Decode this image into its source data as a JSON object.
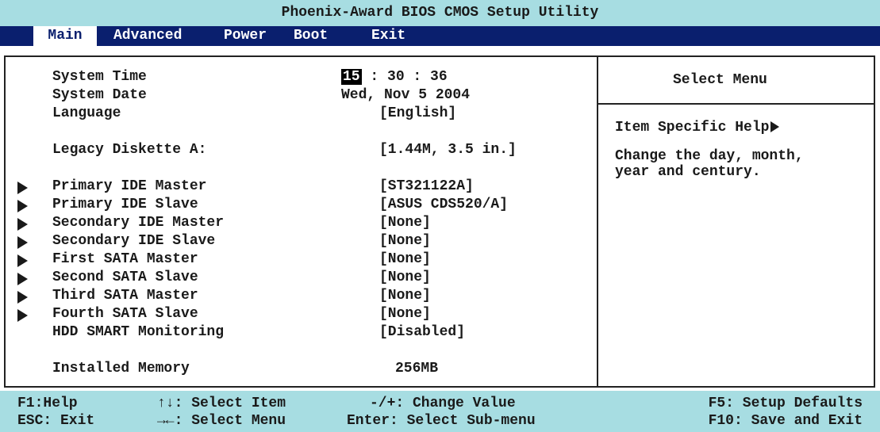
{
  "title": "Phoenix-Award BIOS CMOS Setup Utility",
  "menu": [
    {
      "label": "Main",
      "active": true
    },
    {
      "label": "Advanced",
      "active": false
    },
    {
      "label": "Power",
      "active": false
    },
    {
      "label": "Boot",
      "active": false
    },
    {
      "label": "Exit",
      "active": false
    }
  ],
  "time": {
    "hour": "15",
    "rest": ": 30 : 36"
  },
  "settings": [
    {
      "label": "System Time",
      "value": "",
      "submenu": false
    },
    {
      "label": "System Date",
      "value": "Wed, Nov 5 2004",
      "submenu": false
    },
    {
      "label": "Language",
      "value": "[English]",
      "submenu": false
    },
    {
      "label": "Legacy Diskette A:",
      "value": "[1.44M, 3.5 in.]",
      "submenu": false
    },
    {
      "label": "Primary IDE Master",
      "value": "[ST321122A]",
      "submenu": true
    },
    {
      "label": "Primary IDE Slave",
      "value": "[ASUS CDS520/A]",
      "submenu": true
    },
    {
      "label": "Secondary IDE Master",
      "value": "[None]",
      "submenu": true
    },
    {
      "label": "Secondary IDE Slave",
      "value": "[None]",
      "submenu": true
    },
    {
      "label": "First SATA Master",
      "value": "[None]",
      "submenu": true
    },
    {
      "label": "Second SATA Slave",
      "value": "[None]",
      "submenu": true
    },
    {
      "label": "Third SATA Master",
      "value": "[None]",
      "submenu": true
    },
    {
      "label": "Fourth SATA Slave",
      "value": "[None]",
      "submenu": true
    },
    {
      "label": "HDD SMART Monitoring",
      "value": "[Disabled]",
      "submenu": false
    },
    {
      "label": "Installed Memory",
      "value": "256MB",
      "submenu": false
    }
  ],
  "help": {
    "header": "Select Menu",
    "title": "Item Specific Help",
    "line1": "Change the day, month,",
    "line2": "year and century."
  },
  "footer": {
    "f1": "F1:Help",
    "esc": "ESC: Exit",
    "select_item": "↑↓: Select Item",
    "select_menu": "→←: Select Menu",
    "change_value": "-/+: Change Value",
    "sub_menu": "Enter: Select Sub-menu",
    "f5": "F5: Setup Defaults",
    "f10": "F10: Save and Exit"
  }
}
